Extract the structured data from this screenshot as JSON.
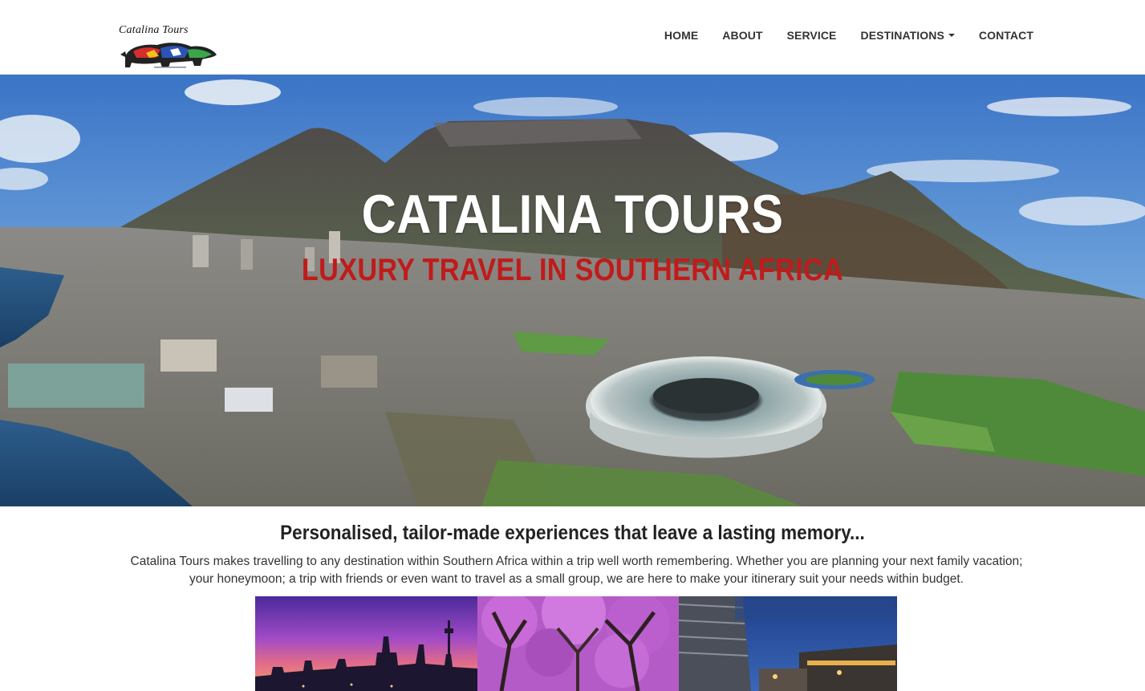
{
  "logo": {
    "text": "Catalina Tours"
  },
  "nav": {
    "items": [
      {
        "label": "HOME"
      },
      {
        "label": "ABOUT"
      },
      {
        "label": "SERVICE"
      },
      {
        "label": "DESTINATIONS"
      },
      {
        "label": "CONTACT"
      }
    ]
  },
  "hero": {
    "title": "CATALINA TOURS",
    "subtitle": "LUXURY TRAVEL IN SOUTHERN AFRICA"
  },
  "main": {
    "tagline": "Personalised, tailor-made experiences that leave a lasting memory...",
    "intro": "Catalina Tours makes travelling to any destination within Southern Africa within a trip well worth remembering. Whether you are planning your next family vacation; your honeymoon; a trip with friends or even want to travel as a small group, we are here to make your itinerary suit your needs within budget."
  },
  "colors": {
    "accent_red": "#c01b1b",
    "nav_text": "#333333"
  }
}
